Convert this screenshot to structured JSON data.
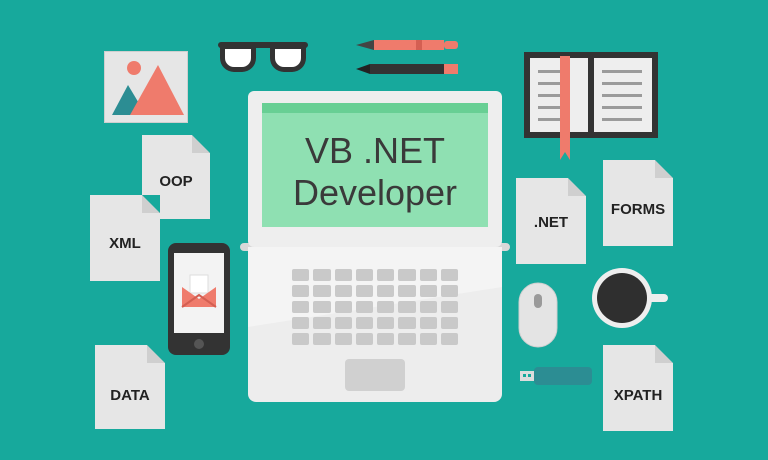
{
  "screen": {
    "line1": "VB .NET",
    "line2": "Developer"
  },
  "documents": {
    "oop": "OOP",
    "xml": "XML",
    "data": "DATA",
    "net": ".NET",
    "forms": "FORMS",
    "xpath": "XPATH"
  },
  "colors": {
    "background": "#17a99c",
    "screen": "#8fe0b2",
    "screen_bar": "#68cf94",
    "salmon": "#ef7b6c",
    "paper": "#e6e6e6"
  },
  "icons": [
    "image-icon",
    "glasses-icon",
    "pen-icon",
    "pencil-icon",
    "notebook-icon",
    "laptop-icon",
    "phone-icon",
    "mail-icon",
    "mouse-icon",
    "coffee-cup-icon",
    "usb-drive-icon"
  ]
}
